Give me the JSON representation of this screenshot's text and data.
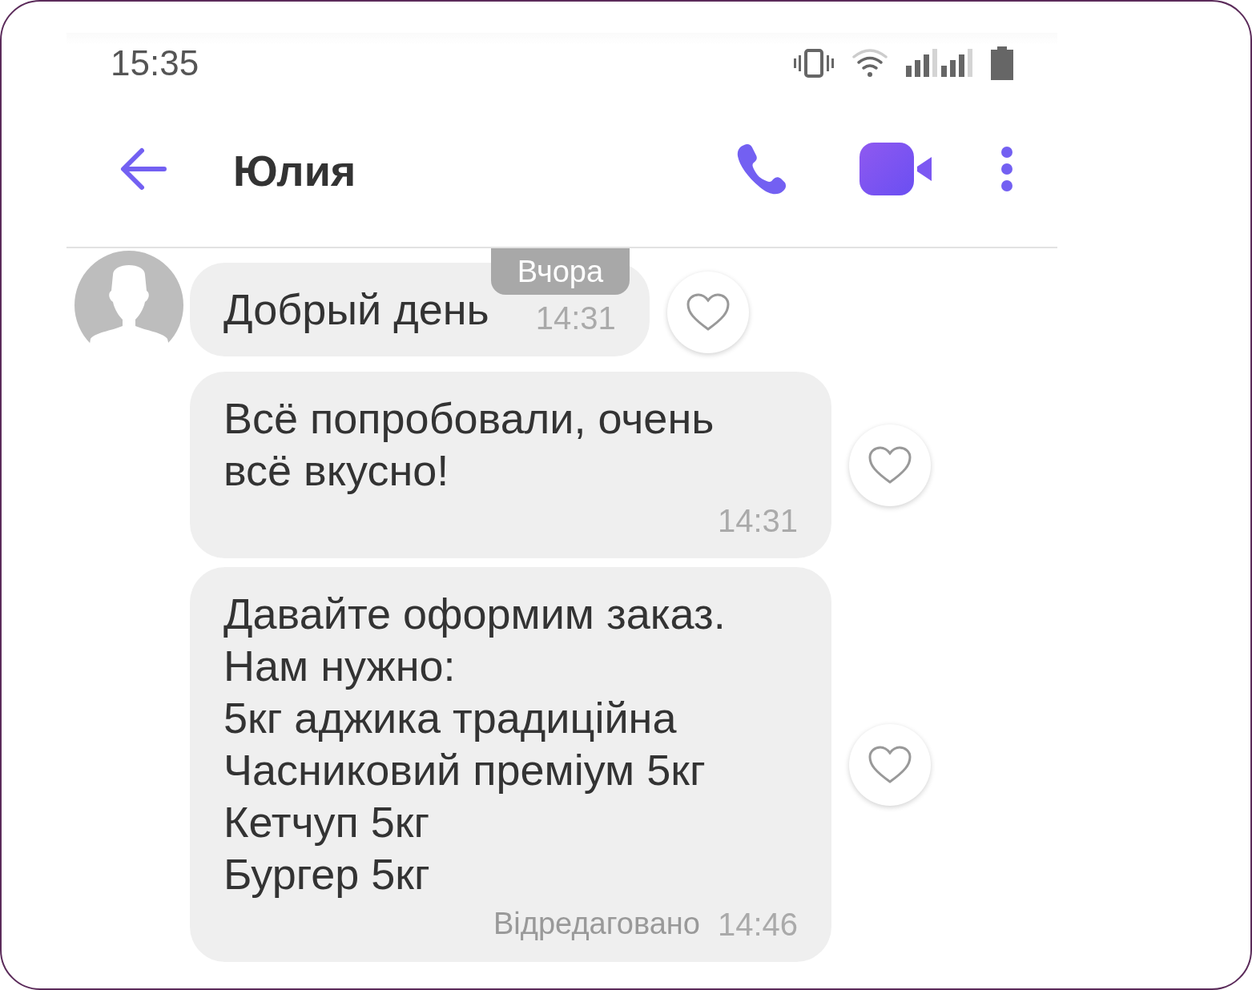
{
  "status_bar": {
    "time": "15:35"
  },
  "header": {
    "title": "Юлия"
  },
  "date_chip": "Вчора",
  "messages": [
    {
      "kind": "inline",
      "avatar": true,
      "text": "Добрый день",
      "time": "14:31",
      "liked": false
    },
    {
      "kind": "stacked",
      "avatar": false,
      "text": "Всё попробовали, очень всё вкусно!",
      "time": "14:31",
      "liked": false
    },
    {
      "kind": "stacked",
      "avatar": false,
      "text": "Давайте оформим заказ.\nНам нужно:\n5кг аджика традиційна\nЧасниковий преміум 5кг\nКетчуп 5кг\nБургер 5кг",
      "edited_label": "Відредаговано",
      "time": "14:46",
      "liked": false
    }
  ]
}
